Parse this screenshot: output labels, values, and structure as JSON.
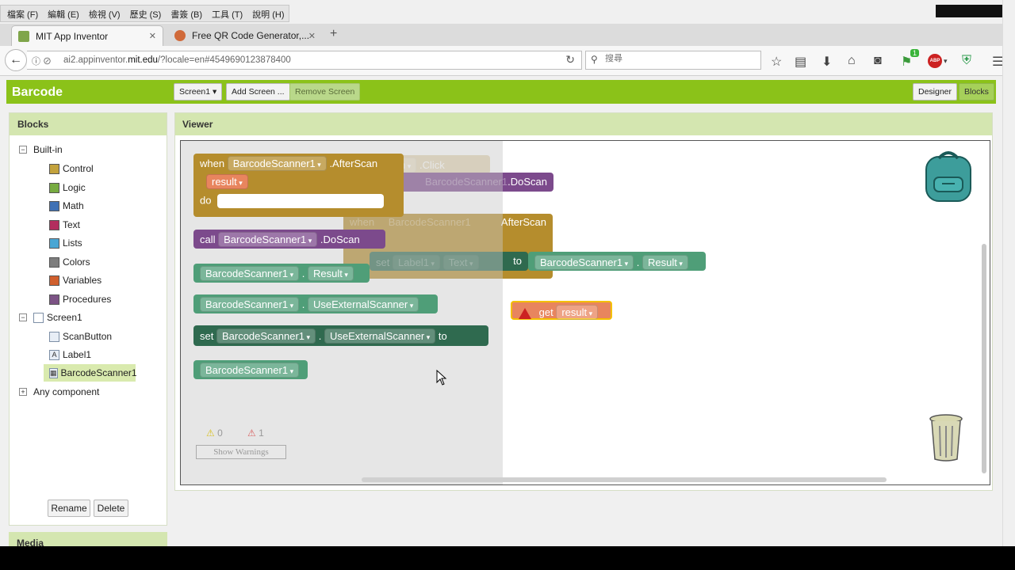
{
  "browser": {
    "menu": [
      "檔案 (F)",
      "編輯 (E)",
      "檢視 (V)",
      "歷史 (S)",
      "書簽 (B)",
      "工具 (T)",
      "說明 (H)"
    ],
    "tabs": [
      {
        "label": "MIT App Inventor",
        "close": "✕"
      },
      {
        "label": "Free QR Code Generator,...",
        "close": "✕"
      }
    ],
    "new_tab": "+",
    "url_host": "ai2.appinventor.",
    "url_domain": "mit.edu",
    "url_path": "/?locale=en#4549690123878400",
    "search_placeholder": "搜尋",
    "addon_badge": "1",
    "abp_label": "ABP"
  },
  "app": {
    "project_name": "Barcode",
    "screen_select": "Screen1 ▾",
    "add_screen": "Add Screen ...",
    "remove_screen": "Remove Screen",
    "designer": "Designer",
    "blocks": "Blocks"
  },
  "blocks_panel": {
    "title": "Blocks",
    "builtin": "Built-in",
    "categories": [
      {
        "label": "Control",
        "color": "#c3a23c"
      },
      {
        "label": "Logic",
        "color": "#77ab41"
      },
      {
        "label": "Math",
        "color": "#3f71b5"
      },
      {
        "label": "Text",
        "color": "#b32d5e"
      },
      {
        "label": "Lists",
        "color": "#49a6d4"
      },
      {
        "label": "Colors",
        "color": "#7d7d7d"
      },
      {
        "label": "Variables",
        "color": "#d05f2d"
      },
      {
        "label": "Procedures",
        "color": "#7c5385"
      }
    ],
    "screen": "Screen1",
    "components": [
      "ScanButton",
      "Label1",
      "BarcodeScanner1"
    ],
    "any_component": "Any component",
    "rename": "Rename",
    "delete": "Delete",
    "media": "Media"
  },
  "viewer": {
    "title": "Viewer",
    "warnings_count": "0",
    "errors_count": "1",
    "show_warnings": "Show Warnings"
  },
  "blocks": {
    "when": "when",
    "do": "do",
    "call": "call",
    "set": "set",
    "to": "to",
    "get": "get",
    "scanner": "BarcodeScanner1",
    "after_scan": ".AfterScan",
    "do_scan": ".DoScan",
    "result_param": "result",
    "result_prop": "Result",
    "use_external": "UseExternalScanner",
    "dot": ".",
    "ghost_button": "Button",
    "ghost_click": ".Click",
    "ghost_label": "Label1",
    "ghost_text": "Text",
    "ghost_afterscan": "AfterScan",
    "ghost_doscan": ".DoScan"
  },
  "colors": {
    "event": "#b58d2d",
    "call": "#7c4a8c",
    "getter": "#4f9e78",
    "setter": "#2f6a4f",
    "param": "#e8855e",
    "header": "#8bc219"
  }
}
